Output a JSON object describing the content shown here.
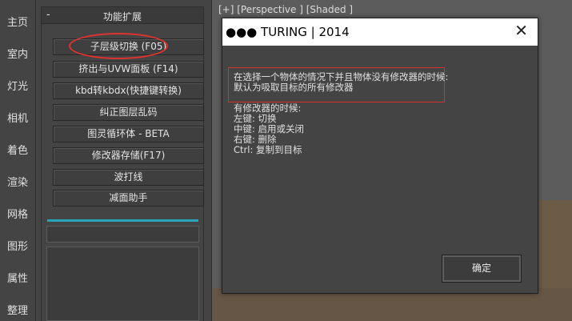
{
  "tabs": [
    "主页",
    "室内",
    "灯光",
    "相机",
    "着色",
    "渲染",
    "网格",
    "图形",
    "属性",
    "整理"
  ],
  "panel": {
    "collapse_symbol": "-",
    "title": "功能扩展",
    "buttons": [
      "子层级切换 (F05)",
      "挤出与UVW面板 (F14)",
      "kbd转kbdx(快捷键转换)",
      "纠正图层乱码",
      "图灵循环体 - BETA",
      "修改器存储(F17)",
      "波打线",
      "减面助手"
    ],
    "input_value": "",
    "accent_color": "#2aa4b8",
    "highlight_color": "#e0322e"
  },
  "viewport": {
    "label": "[+] [Perspective ] [Shaded ]"
  },
  "dialog": {
    "title": "●●● TURING | 2014",
    "close_icon": "close-icon",
    "highlighted_lines": [
      "在选择一个物体的情况下并且物体没有修改器的时候:",
      "默认为吸取目标的所有修改器"
    ],
    "lines": [
      "有修改器的时候:",
      "左键: 切换",
      "中键: 启用或关闭",
      "右键: 删除",
      "Ctrl: 复制到目标"
    ],
    "ok_label": "确定"
  }
}
